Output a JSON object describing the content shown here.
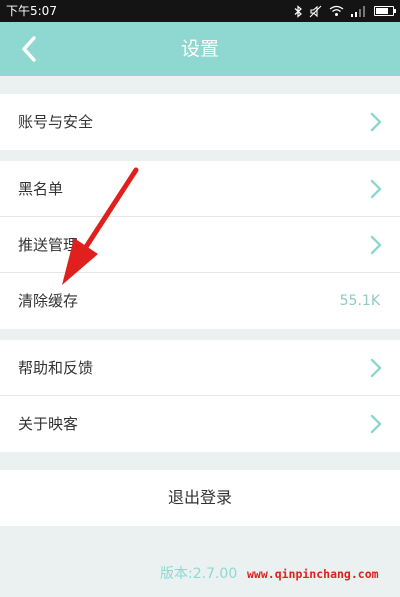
{
  "status_bar": {
    "time": "下午5:07"
  },
  "nav": {
    "title": "设置"
  },
  "sections": [
    {
      "items": [
        {
          "label": "账号与安全",
          "chevron": true
        }
      ]
    },
    {
      "items": [
        {
          "label": "黑名单",
          "chevron": true
        },
        {
          "label": "推送管理",
          "chevron": true
        },
        {
          "label": "清除缓存",
          "value": "55.1K"
        }
      ]
    },
    {
      "items": [
        {
          "label": "帮助和反馈",
          "chevron": true
        },
        {
          "label": "关于映客",
          "chevron": true
        }
      ]
    }
  ],
  "logout_label": "退出登录",
  "version": "版本:2.7.00",
  "watermark": "www.qinpinchang.com",
  "colors": {
    "accent": "#8fd8d1",
    "background": "#eaf1f0",
    "status_bar": "#141414",
    "arrow": "#e0201c",
    "watermark": "#e02020"
  },
  "icons": [
    "back-arrow-icon",
    "chevron-right-icon",
    "bluetooth-icon",
    "mute-icon",
    "wifi-icon",
    "signal-icon",
    "battery-icon"
  ]
}
